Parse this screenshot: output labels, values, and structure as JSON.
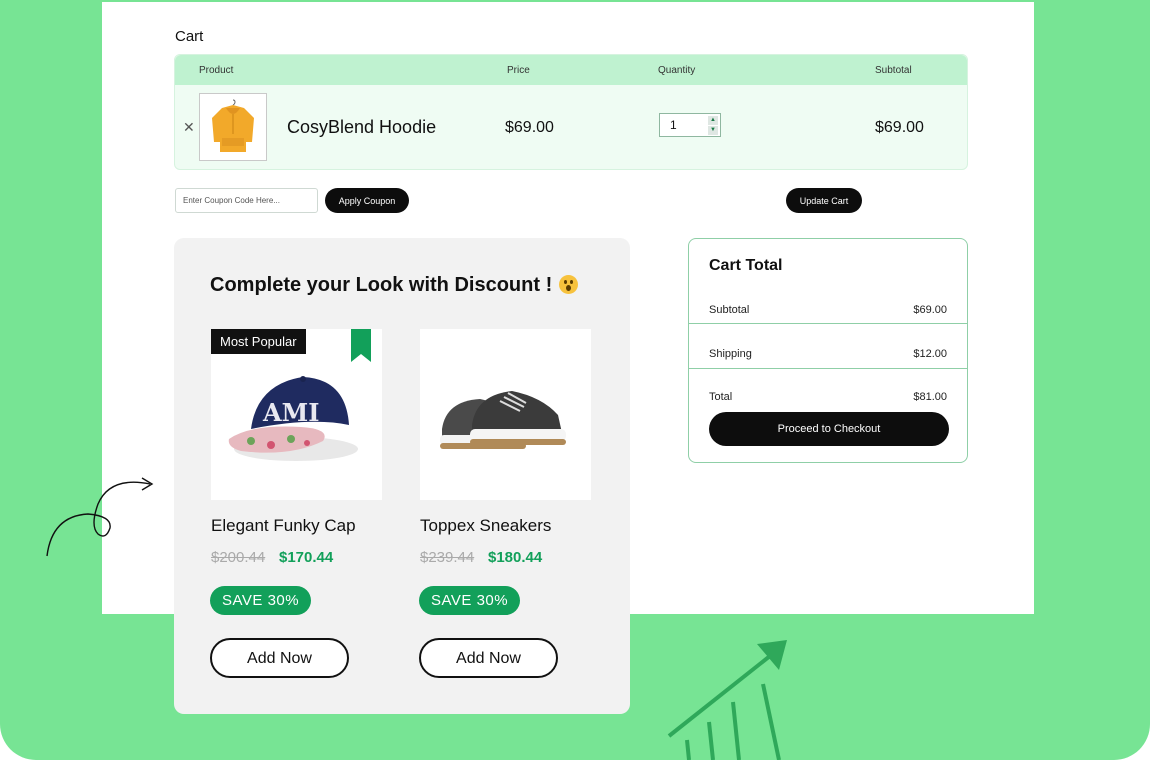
{
  "cart": {
    "title": "Cart",
    "columns": [
      "Product",
      "Price",
      "Quantity",
      "Subtotal"
    ],
    "items": [
      {
        "name": "CosyBlend Hoodie",
        "price": "$69.00",
        "quantity": "1",
        "subtotal": "$69.00",
        "image_icon": "hoodie-image"
      }
    ],
    "coupon_placeholder": "Enter Coupon Code Here...",
    "apply_label": "Apply Coupon",
    "update_label": "Update Cart"
  },
  "recommend": {
    "title": "Complete your Look with Discount !",
    "emoji_icon": "astonished-face-icon",
    "products": [
      {
        "name": "Elegant Funky Cap",
        "old_price": "$200.44",
        "new_price": "$170.44",
        "save": "SAVE 30%",
        "button": "Add Now",
        "badge": "Most Popular"
      },
      {
        "name": "Toppex Sneakers",
        "old_price": "$239.44",
        "new_price": "$180.44",
        "save": "SAVE 30%",
        "button": "Add Now"
      }
    ]
  },
  "totals": {
    "title": "Cart Total",
    "rows": [
      {
        "label": "Subtotal",
        "value": "$69.00"
      },
      {
        "label": "Shipping",
        "value": "$12.00"
      },
      {
        "label": "Total",
        "value": "$81.00"
      }
    ],
    "checkout_label": "Proceed to Checkout"
  },
  "colors": {
    "background_green": "#77e494",
    "accent_green": "#12a05a",
    "header_green": "#bff2d0",
    "row_green": "#effcf3",
    "button_black": "#0d0d0d"
  }
}
